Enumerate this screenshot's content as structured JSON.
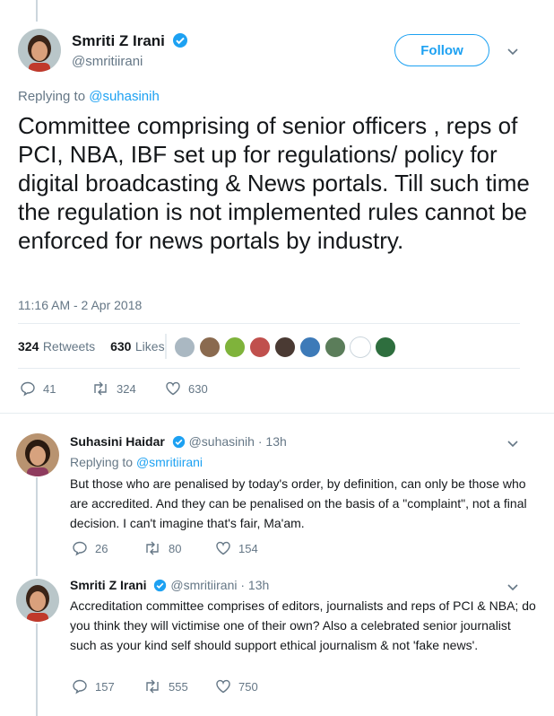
{
  "main_tweet": {
    "author_name": "Smriti Z Irani",
    "author_handle": "@smritiirani",
    "follow_label": "Follow",
    "replying_prefix": "Replying to",
    "replying_handle": "@suhasinih",
    "text": "Committee comprising of senior officers , reps of PCI, NBA, IBF set up for regulations/ policy for digital broadcasting & News portals. Till such time the regulation is not implemented rules cannot be enforced for news portals by industry.",
    "timestamp": "11:16 AM - 2 Apr 2018",
    "retweets_count": "324",
    "retweets_label": "Retweets",
    "likes_count": "630",
    "likes_label": "Likes",
    "actions": {
      "replies": "41",
      "retweets": "324",
      "likes": "630"
    }
  },
  "replies": [
    {
      "author_name": "Suhasini Haidar",
      "author_handle": "@suhasinih",
      "separator": "·",
      "time": "13h",
      "replying_prefix": "Replying to",
      "replying_handle": "@smritiirani",
      "text": "But those who are penalised by today's order, by definition, can only be those who are accredited. And they can be penalised on the basis of a \"complaint\", not a final decision. I can't imagine that's fair, Ma'am.",
      "actions": {
        "replies": "26",
        "retweets": "80",
        "likes": "154"
      }
    },
    {
      "author_name": "Smriti Z Irani",
      "author_handle": "@smritiirani",
      "separator": "·",
      "time": "13h",
      "text": "Accreditation committee comprises of editors, journalists and reps of PCI & NBA; do you think they will victimise one of their own? Also a celebrated senior journalist such as your kind self should support ethical journalism & not 'fake news'.",
      "actions": {
        "replies": "157",
        "retweets": "555",
        "likes": "750"
      }
    }
  ],
  "colors": {
    "accent": "#1da1f2",
    "muted": "#657786",
    "thread_line": "#ccd6dd"
  },
  "icons": [
    "verified-badge-icon",
    "chevron-down-icon",
    "reply-icon",
    "retweet-icon",
    "like-icon"
  ]
}
